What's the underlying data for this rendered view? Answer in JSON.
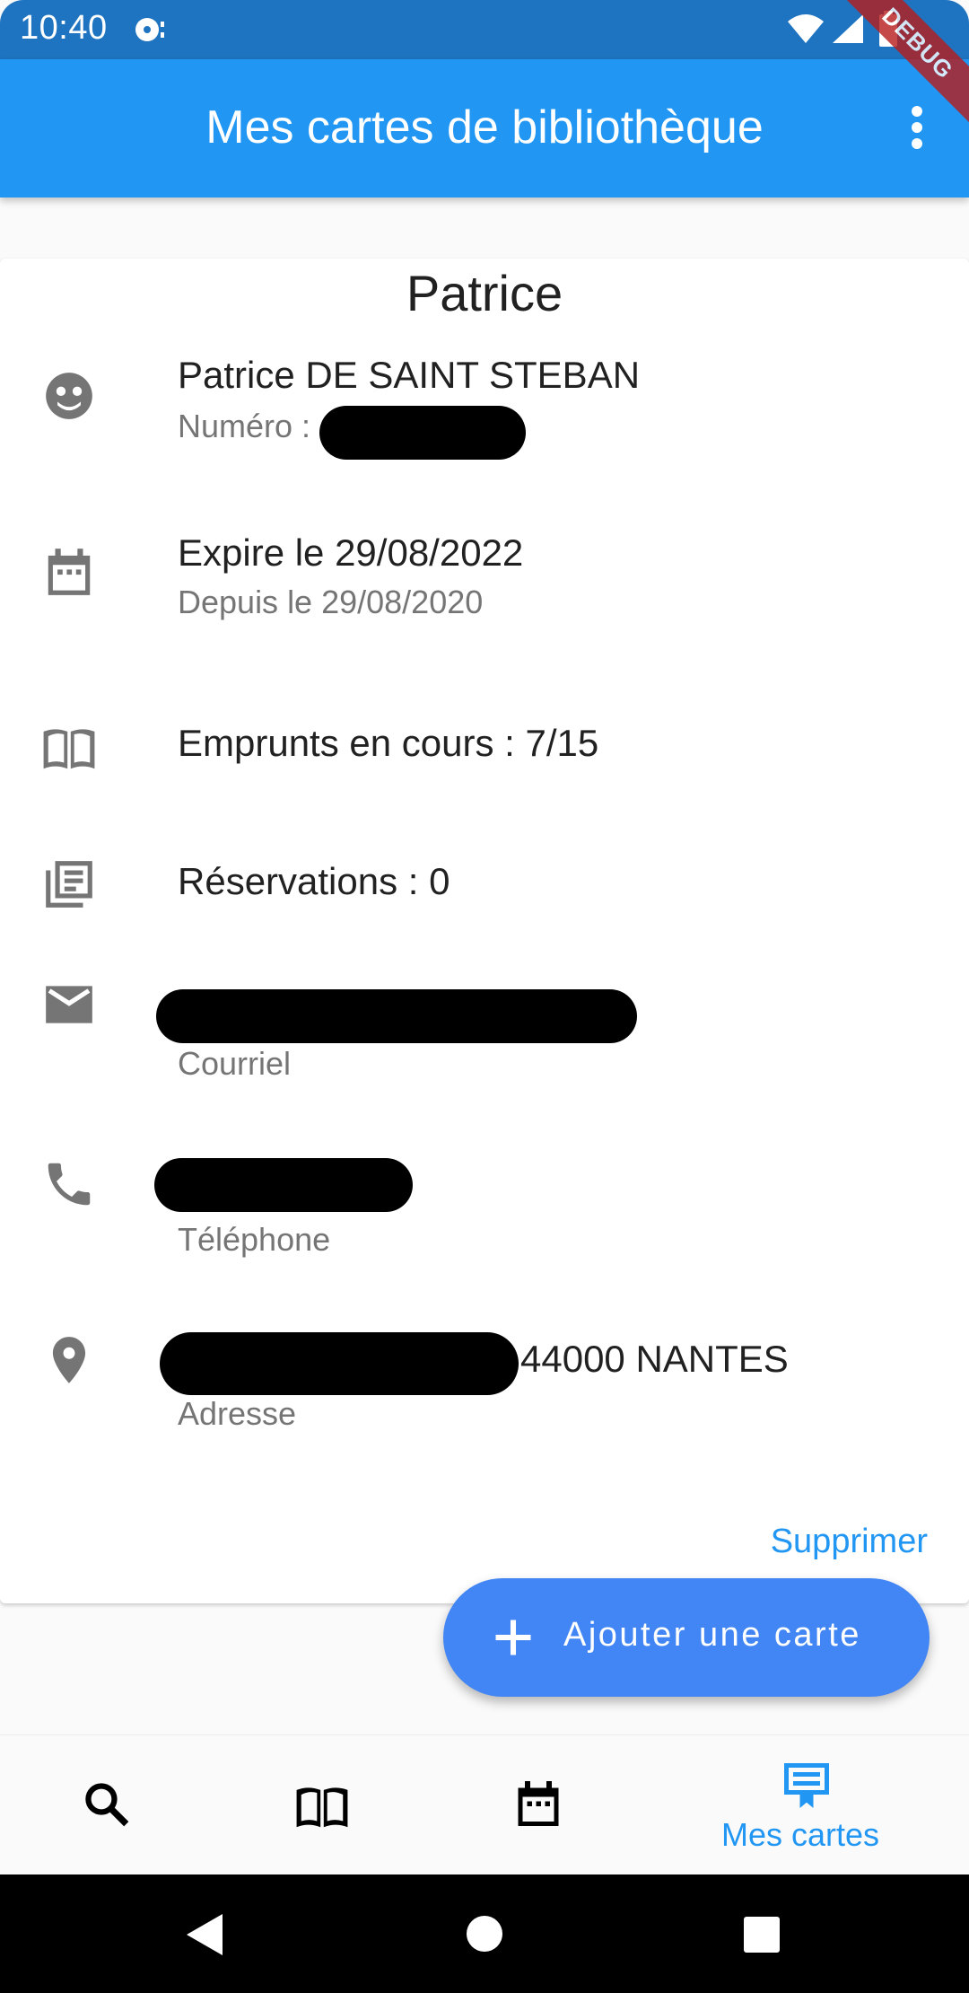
{
  "status_bar": {
    "time": "10:40",
    "icons": [
      "media-icon",
      "wifi-icon",
      "signal-icon",
      "battery-icon"
    ]
  },
  "debug_banner": "DEBUG",
  "app_bar": {
    "title": "Mes cartes de bibliothèque",
    "menu_icon": "more-vert-icon"
  },
  "card": {
    "title": "Patrice",
    "rows": [
      {
        "icon": "face-icon",
        "primary": "Patrice DE SAINT STEBAN",
        "secondary_label": "Numéro :"
      },
      {
        "icon": "calendar-icon",
        "primary": "Expire le 29/08/2022",
        "secondary": "Depuis le 29/08/2020"
      },
      {
        "icon": "book-icon",
        "primary": "Emprunts en cours : 7/15"
      },
      {
        "icon": "library-books-icon",
        "primary": "Réservations : 0"
      },
      {
        "icon": "mail-icon",
        "secondary": "Courriel"
      },
      {
        "icon": "phone-icon",
        "secondary": "Téléphone"
      },
      {
        "icon": "location-icon",
        "primary_visible": "44000 NANTES",
        "secondary": "Adresse"
      }
    ],
    "delete_label": "Supprimer"
  },
  "fab": {
    "label": "Ajouter une carte",
    "icon": "add-icon"
  },
  "bottom_nav": {
    "items": [
      {
        "icon": "search-icon",
        "label": ""
      },
      {
        "icon": "book-icon",
        "label": ""
      },
      {
        "icon": "calendar-icon",
        "label": ""
      },
      {
        "icon": "card-icon",
        "label": "Mes cartes",
        "active": true
      }
    ]
  },
  "colors": {
    "primary": "#2196f3",
    "status_bar": "#1e74c0",
    "fab": "#4285f4",
    "icon_grey": "#757575"
  }
}
